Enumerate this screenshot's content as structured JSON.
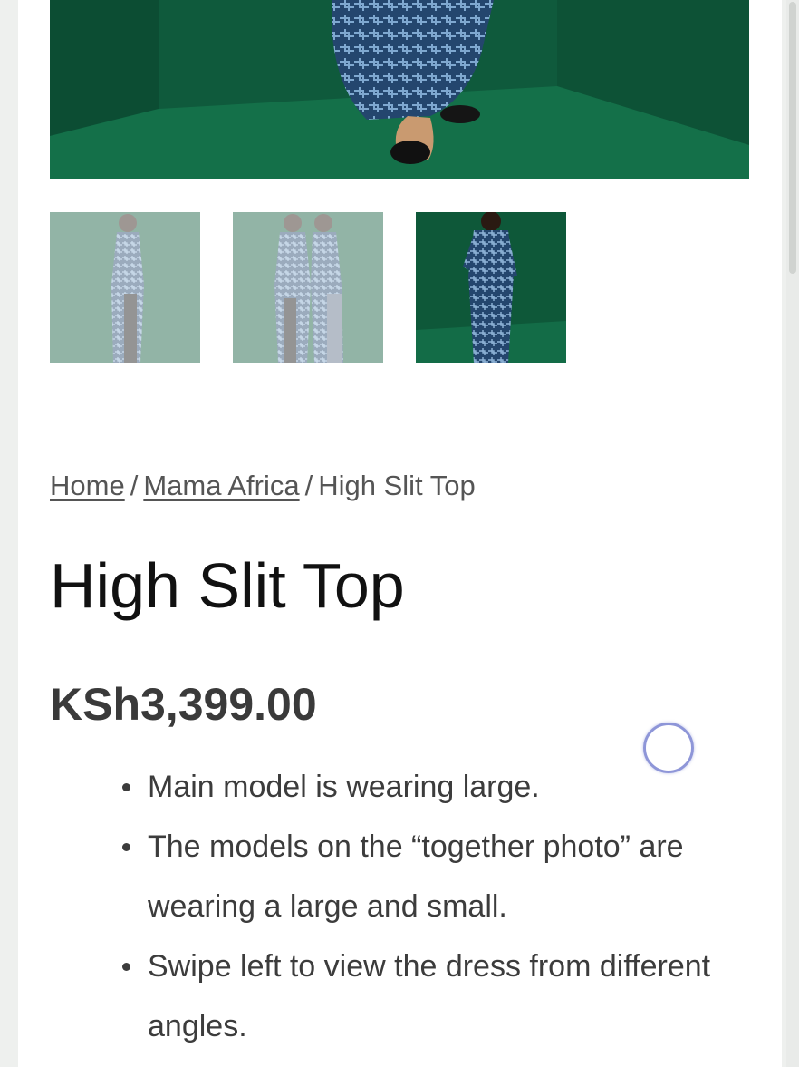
{
  "breadcrumb": {
    "home": "Home",
    "separator": "/",
    "category": "Mama Africa",
    "current": "High Slit Top"
  },
  "product": {
    "title": "High Slit Top",
    "price": "KSh3,399.00",
    "description": [
      "Main model is wearing large.",
      "The models on the “together photo” are wearing a large and small.",
      "Swipe left to view the dress from different angles."
    ]
  },
  "gallery": {
    "thumbnail_count": 3,
    "active_thumbnail": 3
  },
  "colors": {
    "backdrop": "#0f5a3c",
    "dress": "#24466e",
    "text": "#3c3c3c"
  }
}
